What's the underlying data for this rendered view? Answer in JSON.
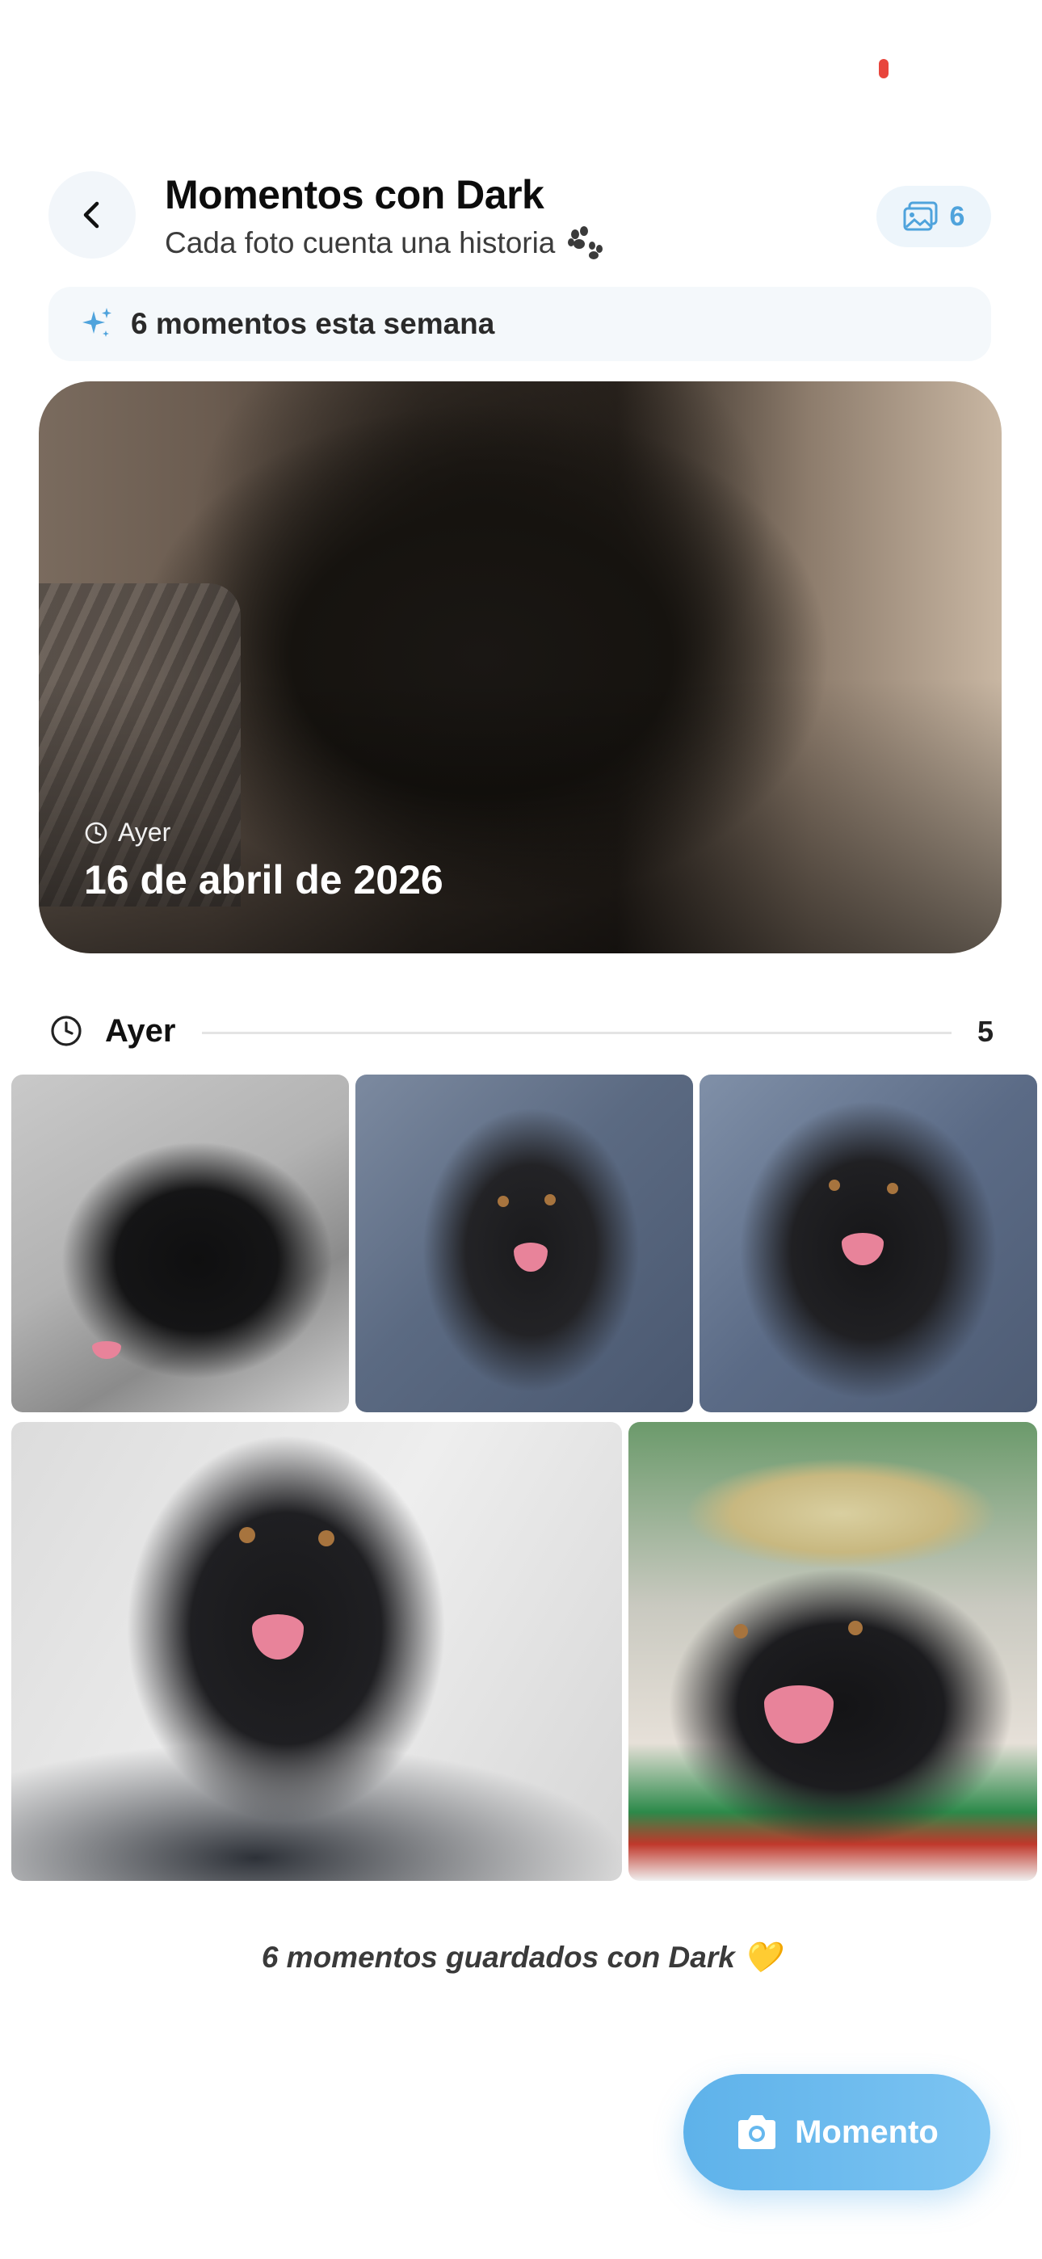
{
  "header": {
    "title": "Momentos con Dark",
    "subtitle": "Cada foto cuenta una historia",
    "photo_count": "6"
  },
  "week_banner": {
    "text": "6 momentos esta semana"
  },
  "hero": {
    "relative_time": "Ayer",
    "date": "16 de abril de 2026"
  },
  "section": {
    "title": "Ayer",
    "count": "5"
  },
  "photos": [
    {
      "alt": "Dark photo 1"
    },
    {
      "alt": "Dark photo 2"
    },
    {
      "alt": "Dark photo 3"
    },
    {
      "alt": "Dark photo 4"
    },
    {
      "alt": "Dark photo 5"
    }
  ],
  "footer": {
    "note": "6 momentos guardados con Dark 💛"
  },
  "fab": {
    "label": "Momento"
  },
  "colors": {
    "accent": "#4fa3dc",
    "fab": "#5eb2ea",
    "status_dot": "#e8453c"
  }
}
